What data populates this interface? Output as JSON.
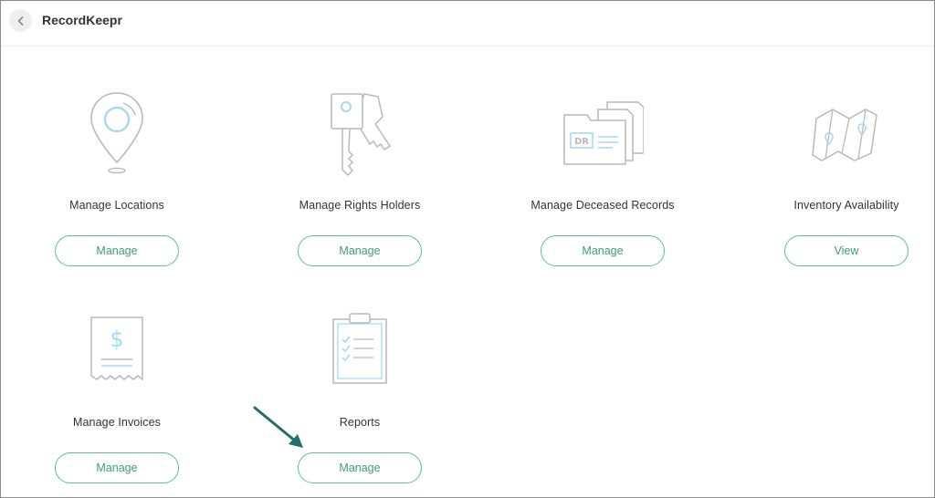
{
  "header": {
    "app_title": "RecordKeepr"
  },
  "cards": [
    {
      "label": "Manage Locations",
      "button": "Manage",
      "icon": "location-pin-icon"
    },
    {
      "label": "Manage Rights Holders",
      "button": "Manage",
      "icon": "keys-icon"
    },
    {
      "label": "Manage Deceased Records",
      "button": "Manage",
      "icon": "folder-documents-icon"
    },
    {
      "label": "Inventory Availability",
      "button": "View",
      "icon": "map-icon"
    },
    {
      "label": "Manage Invoices",
      "button": "Manage",
      "icon": "invoice-icon"
    },
    {
      "label": "Reports",
      "button": "Manage",
      "icon": "clipboard-checklist-icon"
    }
  ],
  "colors": {
    "accent": "#5bbf93",
    "icon_gray": "#b9b9b9",
    "icon_blue": "#a9d8f0",
    "arrow": "#1f6f6f"
  }
}
